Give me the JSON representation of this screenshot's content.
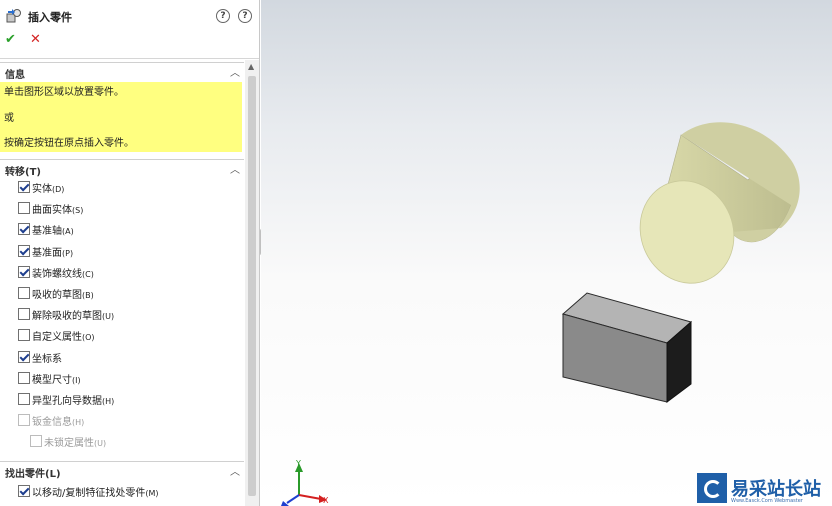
{
  "panel": {
    "title": "插入零件",
    "help_icon_1": "?",
    "help_icon_2": "?",
    "ok_symbol": "✔",
    "cancel_symbol": "✕",
    "info_group": {
      "label": "信息",
      "lines": [
        "单击图形区域以放置零件。",
        "或",
        "按确定按钮在原点插入零件。"
      ],
      "highlight_color": "#ffff80"
    },
    "transfer_group": {
      "label": "转移(T)",
      "options": [
        {
          "label": "实体",
          "shortcut": "(D)",
          "checked": true,
          "enabled": true
        },
        {
          "label": "曲面实体",
          "shortcut": "(S)",
          "checked": false,
          "enabled": true
        },
        {
          "label": "基准轴",
          "shortcut": "(A)",
          "checked": true,
          "enabled": true
        },
        {
          "label": "基准面",
          "shortcut": "(P)",
          "checked": true,
          "enabled": true
        },
        {
          "label": "装饰螺纹线",
          "shortcut": "(C)",
          "checked": true,
          "enabled": true
        },
        {
          "label": "吸收的草图",
          "shortcut": "(B)",
          "checked": false,
          "enabled": true
        },
        {
          "label": "解除吸收的草图",
          "shortcut": "(U)",
          "checked": false,
          "enabled": true
        },
        {
          "label": "自定义属性",
          "shortcut": "(O)",
          "checked": false,
          "enabled": true
        },
        {
          "label": "坐标系",
          "shortcut": "",
          "checked": true,
          "enabled": true
        },
        {
          "label": "模型尺寸",
          "shortcut": "(I)",
          "checked": false,
          "enabled": true
        },
        {
          "label": "异型孔向导数据",
          "shortcut": "(H)",
          "checked": false,
          "enabled": true
        },
        {
          "label": "钣金信息",
          "shortcut": "(H)",
          "checked": false,
          "enabled": false
        },
        {
          "label": "未锁定属性",
          "shortcut": "(U)",
          "checked": false,
          "enabled": false
        }
      ]
    },
    "find_group": {
      "label": "找出零件(L)",
      "options": [
        {
          "label": "以移动/复制特征找处零件",
          "shortcut": "(M)",
          "checked": true,
          "enabled": true
        }
      ]
    }
  },
  "viewport": {
    "triad": {
      "x_label": "X",
      "y_label": "Y"
    },
    "colors": {
      "cylinder": "#e6e6b8",
      "box": "#8a8a8a",
      "box_dark": "#1c1c1c",
      "triad_x": "#d42020",
      "triad_y": "#2a9a2a",
      "triad_z": "#2040d0"
    }
  },
  "watermark": {
    "text": "易采站长站",
    "subtext": "Www.Easck.Com Webmaster"
  }
}
